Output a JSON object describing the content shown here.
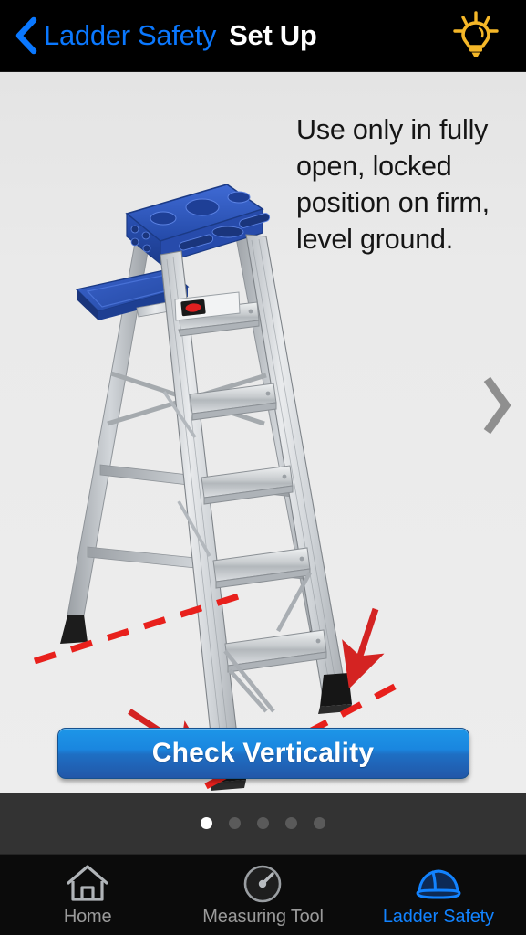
{
  "navbar": {
    "back_icon": "chevron-left-icon",
    "back_label": "Ladder Safety",
    "title": "Set Up",
    "hint_icon": "lightbulb-icon",
    "back_color": "#0a78ff",
    "title_color": "#ffffff",
    "bulb_color": "#f5b728",
    "background": "#000000"
  },
  "content": {
    "instruction": "Use only in fully open, locked position on firm, level ground.",
    "background": "#e7e7e7",
    "illustration": {
      "name": "step-ladder-diagram",
      "description": "Blue-topped aluminum step ladder shown fully open on level ground with red dashed ground lines and red arrows pointing at the ladder feet",
      "accent_line_color": "#e8201c",
      "ladder_top_color": "#2f57b5",
      "ladder_rail_color": "#c9cdd1",
      "foot_color": "#1a1a1a"
    },
    "next_icon": "chevron-right-icon"
  },
  "cta": {
    "label": "Check Verticality",
    "color_top": "#1d96e8",
    "color_bottom": "#2257a8"
  },
  "pager": {
    "total": 5,
    "active_index": 0,
    "active_color": "#ffffff",
    "inactive_color": "#5a5a5a",
    "background": "#333333"
  },
  "tabbar": {
    "background": "#0b0b0b",
    "active_color": "#1283ff",
    "inactive_color": "#9a9a9a",
    "tabs": [
      {
        "label": "Home",
        "icon": "home-icon",
        "active": false
      },
      {
        "label": "Measuring Tool",
        "icon": "gauge-icon",
        "active": false
      },
      {
        "label": "Ladder Safety",
        "icon": "hard-hat-icon",
        "active": true
      }
    ]
  }
}
